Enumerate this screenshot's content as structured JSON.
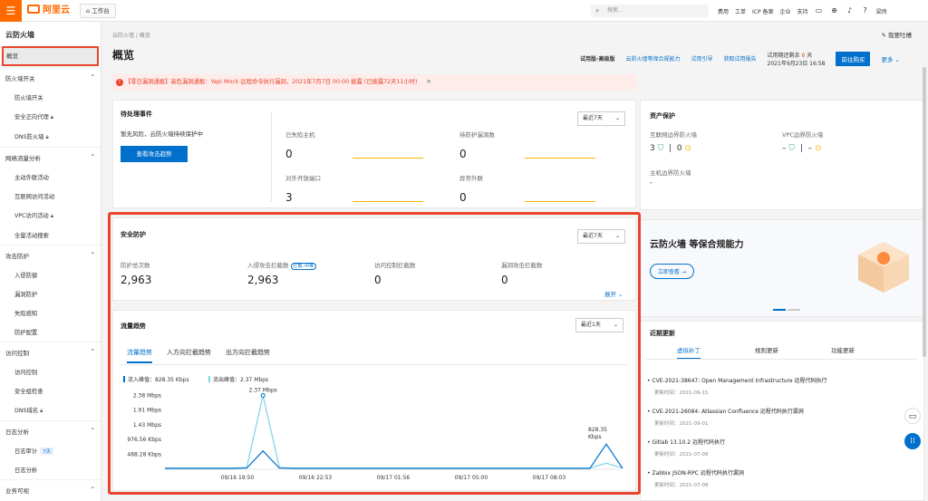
{
  "topbar": {
    "menu_icon": "hamburger-icon",
    "logo_text": "阿里云",
    "workbench": "工作台",
    "search_placeholder": "搜索...",
    "nav": [
      "费用",
      "工单",
      "ICP 备案",
      "企业",
      "支持"
    ],
    "user": "梁炜"
  },
  "sidebar": {
    "title": "云防火墙",
    "active": "概览",
    "groups": [
      {
        "label": "防火墙开关",
        "items": [
          {
            "label": "防火墙开关",
            "lock": false
          },
          {
            "label": "安全正向代理",
            "lock": true
          },
          {
            "label": "DNS防火墙",
            "lock": true
          }
        ]
      },
      {
        "label": "网络流量分析",
        "items": [
          {
            "label": "主动外联活动",
            "lock": false
          },
          {
            "label": "互联网访问活动",
            "lock": false
          },
          {
            "label": "VPC访问活动",
            "lock": true
          },
          {
            "label": "全量活动搜索",
            "lock": false
          }
        ]
      },
      {
        "label": "攻击防护",
        "items": [
          {
            "label": "入侵防御",
            "lock": false
          },
          {
            "label": "漏洞防护",
            "lock": false
          },
          {
            "label": "失陷感知",
            "lock": false
          },
          {
            "label": "防护配置",
            "lock": false
          }
        ]
      },
      {
        "label": "访问控制",
        "items": [
          {
            "label": "访问控制",
            "lock": false
          },
          {
            "label": "安全组检查",
            "lock": false
          },
          {
            "label": "DNS域名",
            "lock": true
          }
        ]
      },
      {
        "label": "日志分析",
        "items": [
          {
            "label": "日志审计",
            "lock": false,
            "badge": "7天"
          },
          {
            "label": "日志分析",
            "lock": false
          }
        ]
      },
      {
        "label": "业务可视",
        "items": []
      }
    ]
  },
  "header": {
    "breadcrumb": [
      "云防火墙",
      "概览"
    ],
    "help": "我要吐槽",
    "title": "概览",
    "edition": "试用版-高级版",
    "links": [
      "云防火墙等保合规能力",
      "试用引导",
      "获取试用报告"
    ],
    "trial_prefix": "试用期还剩余",
    "trial_days": "6",
    "trial_suffix": "天",
    "trial_date": "2021年9月23日 16:58",
    "buy": "前往购买",
    "more": "更多"
  },
  "alert": {
    "tag": "【零日漏洞通报】",
    "text": "高危漏洞通报：Yapi Mock 远程命令执行漏洞，2021年7月7日 00:00 披露 (已披露72天11小时)"
  },
  "pending": {
    "title": "待处理事件",
    "range": "最近7天",
    "no_risk": "暂无风险，云防火墙持续保护中",
    "view_btn": "查看攻击趋势",
    "metrics": [
      {
        "label": "已失陷主机",
        "value": "0"
      },
      {
        "label": "待防护漏洞数",
        "value": "0"
      },
      {
        "label": "对外开放端口",
        "value": "3"
      },
      {
        "label": "异常外联",
        "value": "0"
      }
    ]
  },
  "asset": {
    "title": "资产保护",
    "internet_fw": "互联网边界防火墙",
    "internet_ok": "3",
    "internet_warn": "0",
    "vpc_fw": "VPC边界防火墙",
    "vpc_ok": "–",
    "vpc_warn": "–",
    "host_fw": "主机边界防火墙",
    "host_val": "-"
  },
  "security": {
    "title": "安全防护",
    "range": "最近7天",
    "metrics": [
      {
        "label": "防护总次数",
        "value": "2,963"
      },
      {
        "label": "入侵攻击拦截数",
        "value": "2,963",
        "tag": "拦截–中等"
      },
      {
        "label": "访问控制拦截数",
        "value": "0"
      },
      {
        "label": "漏洞攻击拦截数",
        "value": "0"
      }
    ],
    "expand": "展开"
  },
  "traffic": {
    "title": "流量趋势",
    "range": "最近1天",
    "tabs": [
      "流量趋势",
      "入方向拦截趋势",
      "出方向拦截趋势"
    ],
    "legend_in": "流入峰值：828.35 Kbps",
    "legend_out": "流出峰值：2.37 Mbps",
    "peak_label": "2.37 Mbps",
    "peak2_label_a": "828.35",
    "peak2_label_b": "Kbps",
    "colors": {
      "in": "#0070cc",
      "out": "#7fd3e6"
    }
  },
  "chart_data": {
    "type": "line",
    "yticks": [
      "2.38 Mbps",
      "1.91 Mbps",
      "1.43 Mbps",
      "976.56 Kbps",
      "488.28 Kbps"
    ],
    "xticks": [
      "09/16 19:50",
      "09/16 22:53",
      "09/17 01:56",
      "09/17 05:00",
      "09/17 08:03"
    ],
    "ylim_kbps": [
      0,
      2500
    ],
    "series": [
      {
        "name": "流入峰值：828.35 Kbps",
        "values_kbps": [
          30,
          30,
          30,
          30,
          30,
          40,
          600,
          40,
          30,
          30,
          30,
          30,
          30,
          30,
          30,
          30,
          30,
          30,
          30,
          30,
          30,
          30,
          30,
          30,
          30,
          30,
          30,
          828,
          30
        ]
      },
      {
        "name": "流出峰值：2.37 Mbps",
        "values_kbps": [
          40,
          40,
          40,
          40,
          40,
          60,
          2427,
          60,
          40,
          40,
          40,
          40,
          40,
          40,
          40,
          40,
          40,
          40,
          40,
          40,
          40,
          40,
          40,
          40,
          40,
          40,
          40,
          200,
          40
        ]
      }
    ]
  },
  "promo": {
    "title": "云防火墙 等保合规能力",
    "btn": "立即查看"
  },
  "updates": {
    "title": "近期更新",
    "tabs": [
      "虚拟补丁",
      "规则更新",
      "功能更新"
    ],
    "time_prefix": "更新时间：",
    "items": [
      {
        "title": "CVE-2021-38647: Open Management Infrastructure 远程代码执行",
        "time": "2021-09-15"
      },
      {
        "title": "CVE-2021-26084: Atlassian Confluence 远程代码执行漏洞",
        "time": "2021-09-01"
      },
      {
        "title": "Gitlab 13.10.2 远程代码执行",
        "time": "2021-07-08"
      },
      {
        "title": "Zabbix JSON-RPC 远程代码执行漏洞",
        "time": "2021-07-08"
      }
    ]
  }
}
